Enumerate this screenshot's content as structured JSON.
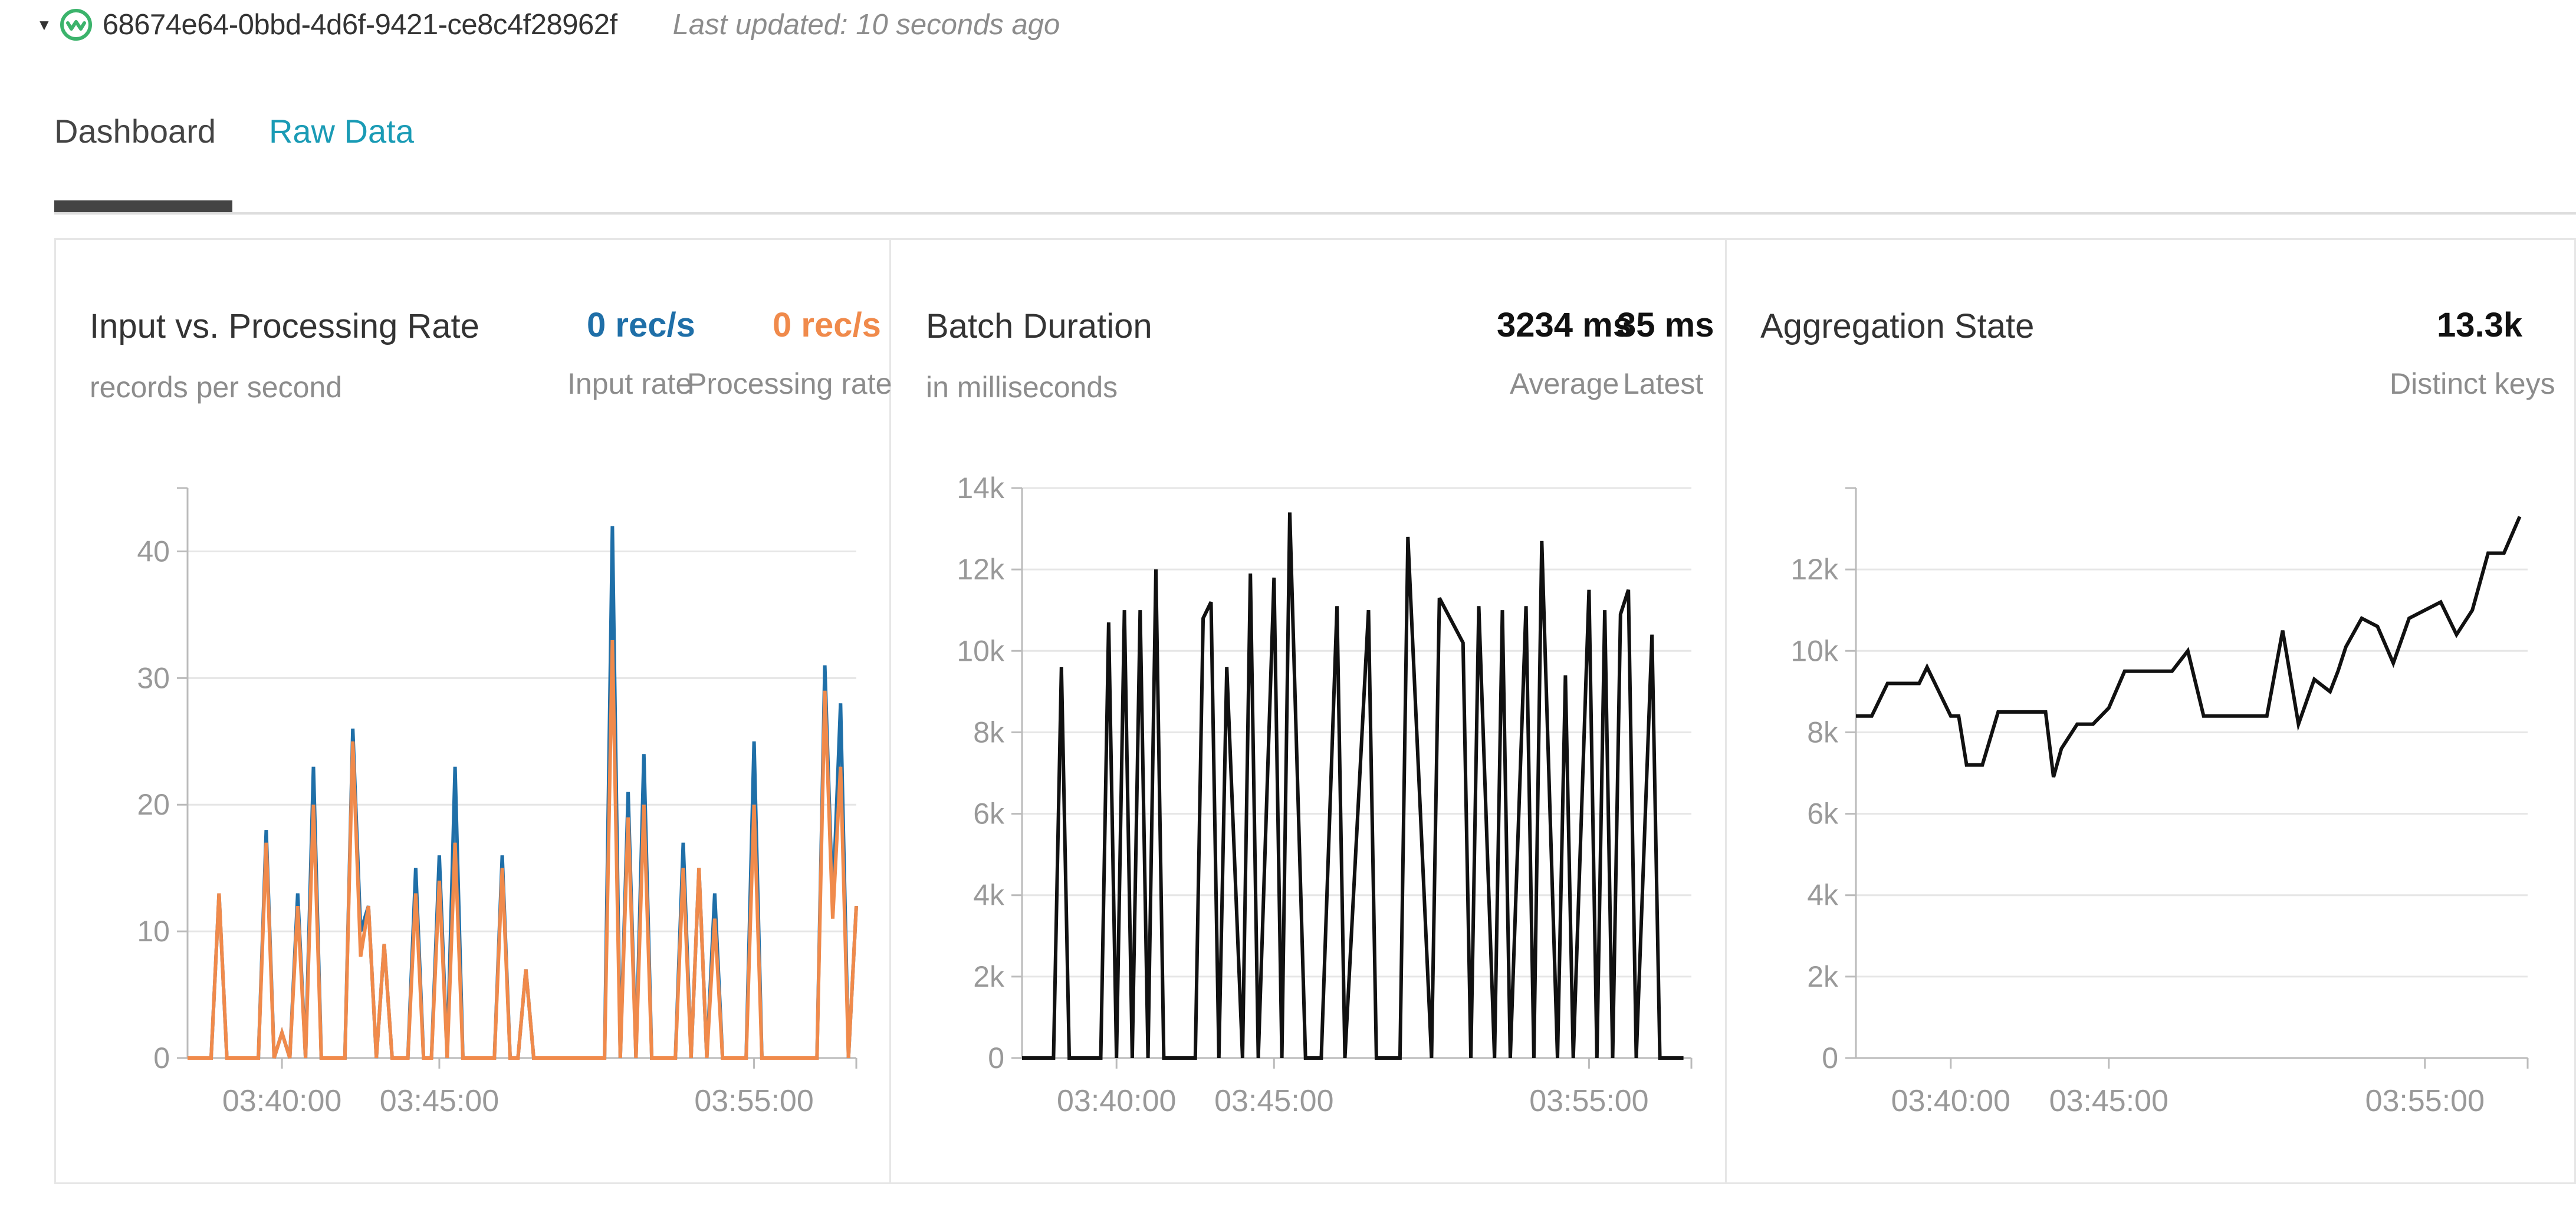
{
  "header": {
    "query_id": "68674e64-0bbd-4d6f-9421-ce8c4f28962f",
    "last_updated": "Last updated: 10 seconds ago",
    "icon": "streaming-query-status-icon",
    "accent_color": "#3bb36b"
  },
  "tabs": [
    {
      "label": "Dashboard",
      "active": true
    },
    {
      "label": "Raw Data",
      "active": false
    }
  ],
  "panels": {
    "input_rate": {
      "title": "Input vs. Processing Rate",
      "subtitle": "records per second",
      "stats": [
        {
          "value": "0 rec/s",
          "label": "Input rate",
          "color": "#1f6fa8"
        },
        {
          "value": "0 rec/s",
          "label": "Processing rate",
          "color": "#f08a4b"
        }
      ]
    },
    "batch_duration": {
      "title": "Batch Duration",
      "subtitle": "in milliseconds",
      "stats": [
        {
          "value": "3234 ms",
          "label": "Average"
        },
        {
          "value": "35 ms",
          "label": "Latest"
        }
      ]
    },
    "aggregation_state": {
      "title": "Aggregation State",
      "stats": [
        {
          "value": "13.3k",
          "label": "Distinct keys"
        }
      ]
    }
  },
  "chart_data": [
    {
      "type": "line",
      "x": [
        "03:37:00",
        "03:37:30",
        "03:37:45",
        "03:38:00",
        "03:38:15",
        "03:38:30",
        "03:38:45",
        "03:39:00",
        "03:39:15",
        "03:39:30",
        "03:39:45",
        "03:40:00",
        "03:40:15",
        "03:40:30",
        "03:40:45",
        "03:41:00",
        "03:41:15",
        "03:41:30",
        "03:41:45",
        "03:42:00",
        "03:42:15",
        "03:42:30",
        "03:42:45",
        "03:43:00",
        "03:43:15",
        "03:43:30",
        "03:43:45",
        "03:44:00",
        "03:44:15",
        "03:44:30",
        "03:44:45",
        "03:45:00",
        "03:45:15",
        "03:45:30",
        "03:45:45",
        "03:46:00",
        "03:46:15",
        "03:46:30",
        "03:46:45",
        "03:47:00",
        "03:47:15",
        "03:47:30",
        "03:47:45",
        "03:48:00",
        "03:48:15",
        "03:48:30",
        "03:48:45",
        "03:49:00",
        "03:49:15",
        "03:49:30",
        "03:49:45",
        "03:50:00",
        "03:50:15",
        "03:50:30",
        "03:50:45",
        "03:51:00",
        "03:51:15",
        "03:51:30",
        "03:51:45",
        "03:52:00",
        "03:52:15",
        "03:52:30",
        "03:52:45",
        "03:53:00",
        "03:53:15",
        "03:53:30",
        "03:53:45",
        "03:54:00",
        "03:54:15",
        "03:54:30",
        "03:54:45",
        "03:55:00",
        "03:55:15",
        "03:55:30",
        "03:55:45",
        "03:56:00",
        "03:56:15",
        "03:56:30",
        "03:56:45",
        "03:57:00",
        "03:57:15",
        "03:57:30",
        "03:57:45",
        "03:58:00",
        "03:58:15"
      ],
      "series": [
        {
          "color": "#1f6fa8",
          "values": [
            0,
            0,
            0,
            13,
            0,
            0,
            0,
            0,
            0,
            18,
            0,
            2,
            0,
            13,
            0,
            23,
            0,
            0,
            0,
            0,
            26,
            10,
            12,
            0,
            9,
            0,
            0,
            0,
            15,
            0,
            0,
            16,
            0,
            23,
            0,
            0,
            0,
            0,
            0,
            16,
            0,
            0,
            7,
            0,
            0,
            0,
            0,
            0,
            0,
            0,
            0,
            0,
            0,
            42,
            0,
            21,
            0,
            24,
            0,
            0,
            0,
            0,
            17,
            0,
            15,
            0,
            13,
            0,
            0,
            0,
            0,
            25,
            0,
            0,
            0,
            0,
            0,
            0,
            0,
            0,
            31,
            12,
            28,
            0,
            12
          ]
        },
        {
          "color": "#f08a4b",
          "values": [
            0,
            0,
            0,
            13,
            0,
            0,
            0,
            0,
            0,
            17,
            0,
            2,
            0,
            12,
            0,
            20,
            0,
            0,
            0,
            0,
            25,
            8,
            12,
            0,
            9,
            0,
            0,
            0,
            13,
            0,
            0,
            14,
            0,
            17,
            0,
            0,
            0,
            0,
            0,
            15,
            0,
            0,
            7,
            0,
            0,
            0,
            0,
            0,
            0,
            0,
            0,
            0,
            0,
            33,
            0,
            19,
            0,
            20,
            0,
            0,
            0,
            0,
            15,
            0,
            15,
            0,
            11,
            0,
            0,
            0,
            0,
            20,
            0,
            0,
            0,
            0,
            0,
            0,
            0,
            0,
            29,
            11,
            23,
            0,
            12
          ]
        }
      ],
      "ylim": [
        0,
        45
      ],
      "yticks": [
        "0",
        "10",
        "20",
        "30",
        "40"
      ],
      "xticks": [
        "03:40:00",
        "03:45:00",
        "03:55:00"
      ],
      "grid": true
    },
    {
      "type": "line",
      "x": [
        "03:37:00",
        "03:37:30",
        "03:38:00",
        "03:38:15",
        "03:38:30",
        "03:39:00",
        "03:39:30",
        "03:39:45",
        "03:40:00",
        "03:40:15",
        "03:40:30",
        "03:40:45",
        "03:41:00",
        "03:41:15",
        "03:41:30",
        "03:42:00",
        "03:42:30",
        "03:42:45",
        "03:43:00",
        "03:43:15",
        "03:43:30",
        "03:44:00",
        "03:44:15",
        "03:44:30",
        "03:45:00",
        "03:45:15",
        "03:45:30",
        "03:46:00",
        "03:46:15",
        "03:46:30",
        "03:47:00",
        "03:47:15",
        "03:48:00",
        "03:48:15",
        "03:49:00",
        "03:49:15",
        "03:50:00",
        "03:50:15",
        "03:51:00",
        "03:51:15",
        "03:51:30",
        "03:52:00",
        "03:52:15",
        "03:52:30",
        "03:53:00",
        "03:53:15",
        "03:53:30",
        "03:54:00",
        "03:54:15",
        "03:54:30",
        "03:55:00",
        "03:55:15",
        "03:55:30",
        "03:55:45",
        "03:56:00",
        "03:56:15",
        "03:56:30",
        "03:57:00",
        "03:57:15",
        "03:57:30",
        "03:58:00"
      ],
      "series": [
        {
          "color": "#111111",
          "values": [
            0,
            0,
            0,
            9600,
            0,
            0,
            0,
            10700,
            0,
            11000,
            0,
            11000,
            0,
            12000,
            0,
            0,
            0,
            10800,
            11200,
            0,
            9600,
            0,
            11900,
            0,
            11800,
            0,
            13400,
            0,
            0,
            0,
            11100,
            0,
            11000,
            0,
            0,
            12800,
            0,
            11300,
            10200,
            0,
            11100,
            0,
            11000,
            0,
            11100,
            0,
            12700,
            0,
            9400,
            0,
            11500,
            0,
            11000,
            0,
            10900,
            11500,
            0,
            10400,
            0,
            0,
            0
          ]
        }
      ],
      "ylim": [
        0,
        14000
      ],
      "yticks": [
        "0",
        "2k",
        "4k",
        "6k",
        "8k",
        "10k",
        "12k",
        "14k"
      ],
      "xticks": [
        "03:40:00",
        "03:45:00",
        "03:55:00"
      ],
      "grid": true
    },
    {
      "type": "line",
      "x": [
        "03:37:00",
        "03:37:30",
        "03:38:00",
        "03:38:30",
        "03:39:00",
        "03:39:15",
        "03:39:30",
        "03:40:00",
        "03:40:15",
        "03:40:30",
        "03:41:00",
        "03:41:30",
        "03:42:00",
        "03:42:30",
        "03:43:00",
        "03:43:15",
        "03:43:30",
        "03:44:00",
        "03:44:30",
        "03:45:00",
        "03:45:30",
        "03:46:00",
        "03:46:30",
        "03:47:00",
        "03:47:30",
        "03:48:00",
        "03:48:30",
        "03:49:00",
        "03:49:30",
        "03:50:00",
        "03:50:30",
        "03:51:00",
        "03:51:30",
        "03:52:00",
        "03:52:15",
        "03:52:30",
        "03:53:00",
        "03:53:30",
        "03:54:00",
        "03:54:30",
        "03:55:00",
        "03:55:30",
        "03:56:00",
        "03:56:30",
        "03:57:00",
        "03:57:30",
        "03:58:00"
      ],
      "series": [
        {
          "color": "#111111",
          "values": [
            8400,
            8400,
            9200,
            9200,
            9200,
            9600,
            9200,
            8400,
            8400,
            7200,
            7200,
            8500,
            8500,
            8500,
            8500,
            6900,
            7600,
            8200,
            8200,
            8600,
            9500,
            9500,
            9500,
            9500,
            10000,
            8400,
            8400,
            8400,
            8400,
            8400,
            10500,
            8200,
            9300,
            9000,
            9500,
            10100,
            10800,
            10600,
            9700,
            10800,
            11000,
            11200,
            10400,
            11000,
            12400,
            12400,
            13300
          ]
        }
      ],
      "ylim": [
        0,
        14000
      ],
      "yticks": [
        "0",
        "2k",
        "4k",
        "6k",
        "8k",
        "10k",
        "12k"
      ],
      "xticks": [
        "03:40:00",
        "03:45:00",
        "03:55:00"
      ],
      "grid": true
    }
  ]
}
